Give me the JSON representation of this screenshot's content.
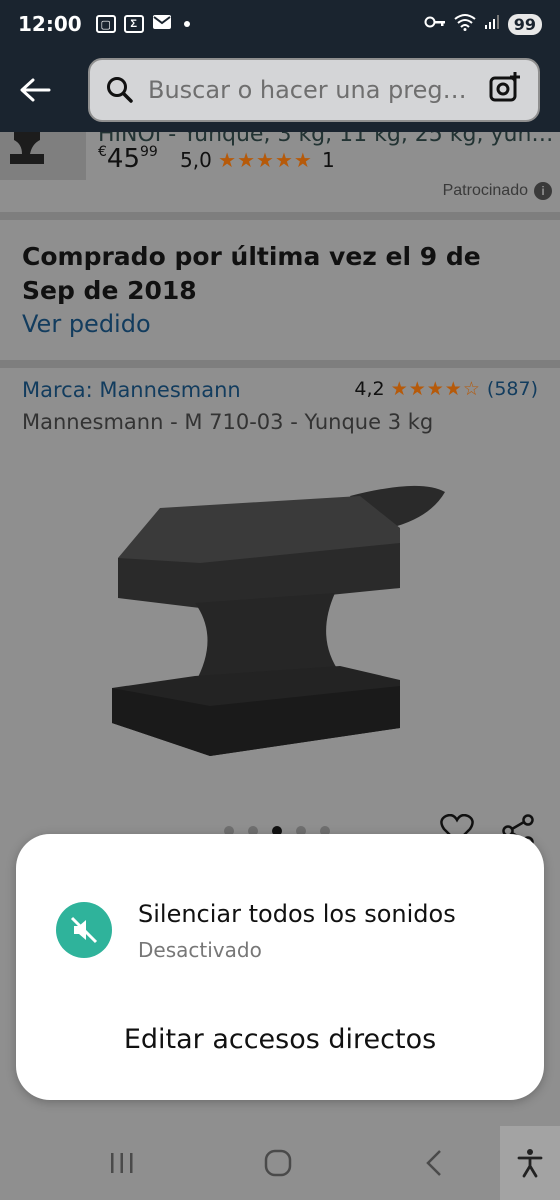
{
  "status_bar": {
    "time": "12:00",
    "battery": "99"
  },
  "search": {
    "placeholder": "Buscar o hacer una preg…"
  },
  "sponsored": {
    "title": "HINOI - Yunque, 3 kg, 11 kg, 25 kg, yun…",
    "price_currency": "€",
    "price_whole": "45",
    "price_cents": "99",
    "rating": "5,0",
    "stars": "★★★★★",
    "review_count": "1",
    "label": "Patrocinado"
  },
  "purchase": {
    "title": "Comprado por última vez el 9 de Sep de 2018",
    "view_order": "Ver pedido"
  },
  "product": {
    "brand": "Marca: Mannesmann",
    "rating": "4,2",
    "stars": "★★★★☆",
    "review_count": "(587)",
    "title": "Mannesmann - M 710-03 - Yunque 3 kg",
    "carousel_total": 5,
    "carousel_active": 3
  },
  "sheet": {
    "mute_title": "Silenciar todos los sonidos",
    "mute_status": "Desactivado",
    "edit_shortcuts": "Editar accesos directos"
  },
  "colors": {
    "status_bar_bg": "#1a242f",
    "mute_accent": "#2fb39b",
    "link": "#123c5e",
    "star": "#b65a0a"
  }
}
